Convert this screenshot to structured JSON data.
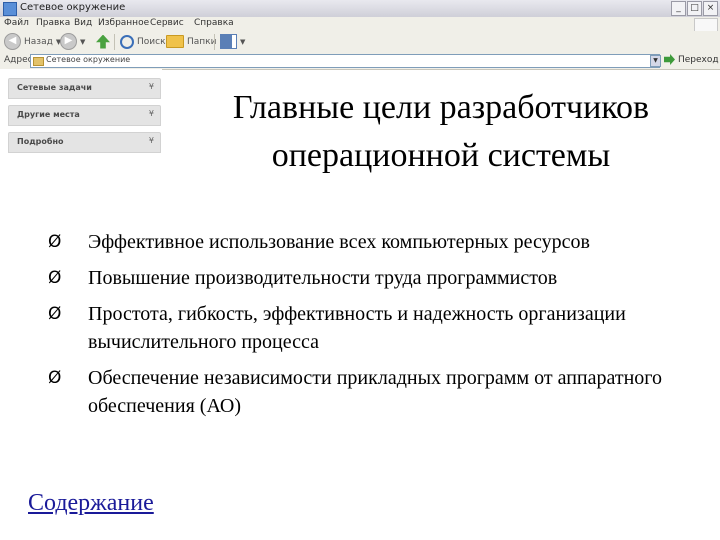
{
  "window": {
    "title": "Сетевое окружение",
    "menu": [
      "Файл",
      "Правка",
      "Вид",
      "Избранное",
      "Сервис",
      "Справка"
    ],
    "controls": [
      "_",
      "□",
      "×"
    ]
  },
  "toolbar": {
    "back_label": "Назад",
    "search_label": "Поиск",
    "folders_label": "Папки"
  },
  "address": {
    "label": "Адрес:",
    "value": "Сетевое окружение",
    "go_label": "Переход"
  },
  "task_pane": {
    "panels": [
      {
        "label": "Сетевые задачи"
      },
      {
        "label": "Другие места"
      },
      {
        "label": "Подробно"
      }
    ]
  },
  "slide": {
    "title_line1": "Главные цели разработчиков",
    "title_line2": "операционной системы",
    "bullet_marker": "Ø",
    "bullets": [
      "Эффективное использование всех компьютерных ресурсов",
      "Повышение производительности труда программистов",
      "Простота, гибкость, эффективность и надежность организации вычислительного процесса",
      "Обеспечение независимости прикладных программ от аппаратного обеспечения (АО)"
    ],
    "contents_link": "Содержание"
  }
}
